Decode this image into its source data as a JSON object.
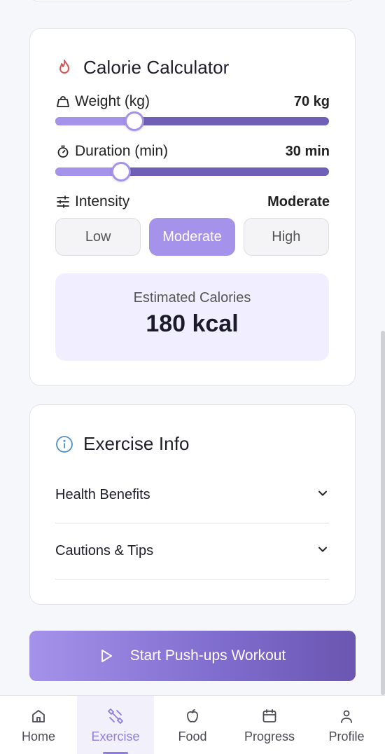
{
  "calculator": {
    "title": "Calorie Calculator",
    "weight": {
      "label": "Weight (kg)",
      "value_text": "70 kg",
      "level": 0.29
    },
    "duration": {
      "label": "Duration (min)",
      "value_text": "30 min",
      "level": 0.24
    },
    "intensity": {
      "label": "Intensity",
      "value_text": "Moderate",
      "options": [
        "Low",
        "Moderate",
        "High"
      ],
      "selected": "Moderate"
    },
    "result": {
      "label": "Estimated Calories",
      "value": "180 kcal"
    }
  },
  "info": {
    "title": "Exercise Info",
    "items": [
      "Health Benefits",
      "Cautions & Tips"
    ]
  },
  "start_button": {
    "label": "Start Push-ups Workout"
  },
  "nav": {
    "items": [
      {
        "label": "Home",
        "icon": "home-icon"
      },
      {
        "label": "Exercise",
        "icon": "dumbbell-icon"
      },
      {
        "label": "Food",
        "icon": "apple-icon"
      },
      {
        "label": "Progress",
        "icon": "calendar-icon"
      },
      {
        "label": "Profile",
        "icon": "person-icon"
      }
    ],
    "active": "Exercise"
  },
  "colors": {
    "accent": "#a592ea",
    "accent_dark": "#6f5fb7",
    "flame": "#d9534f",
    "info": "#4a90c8"
  }
}
